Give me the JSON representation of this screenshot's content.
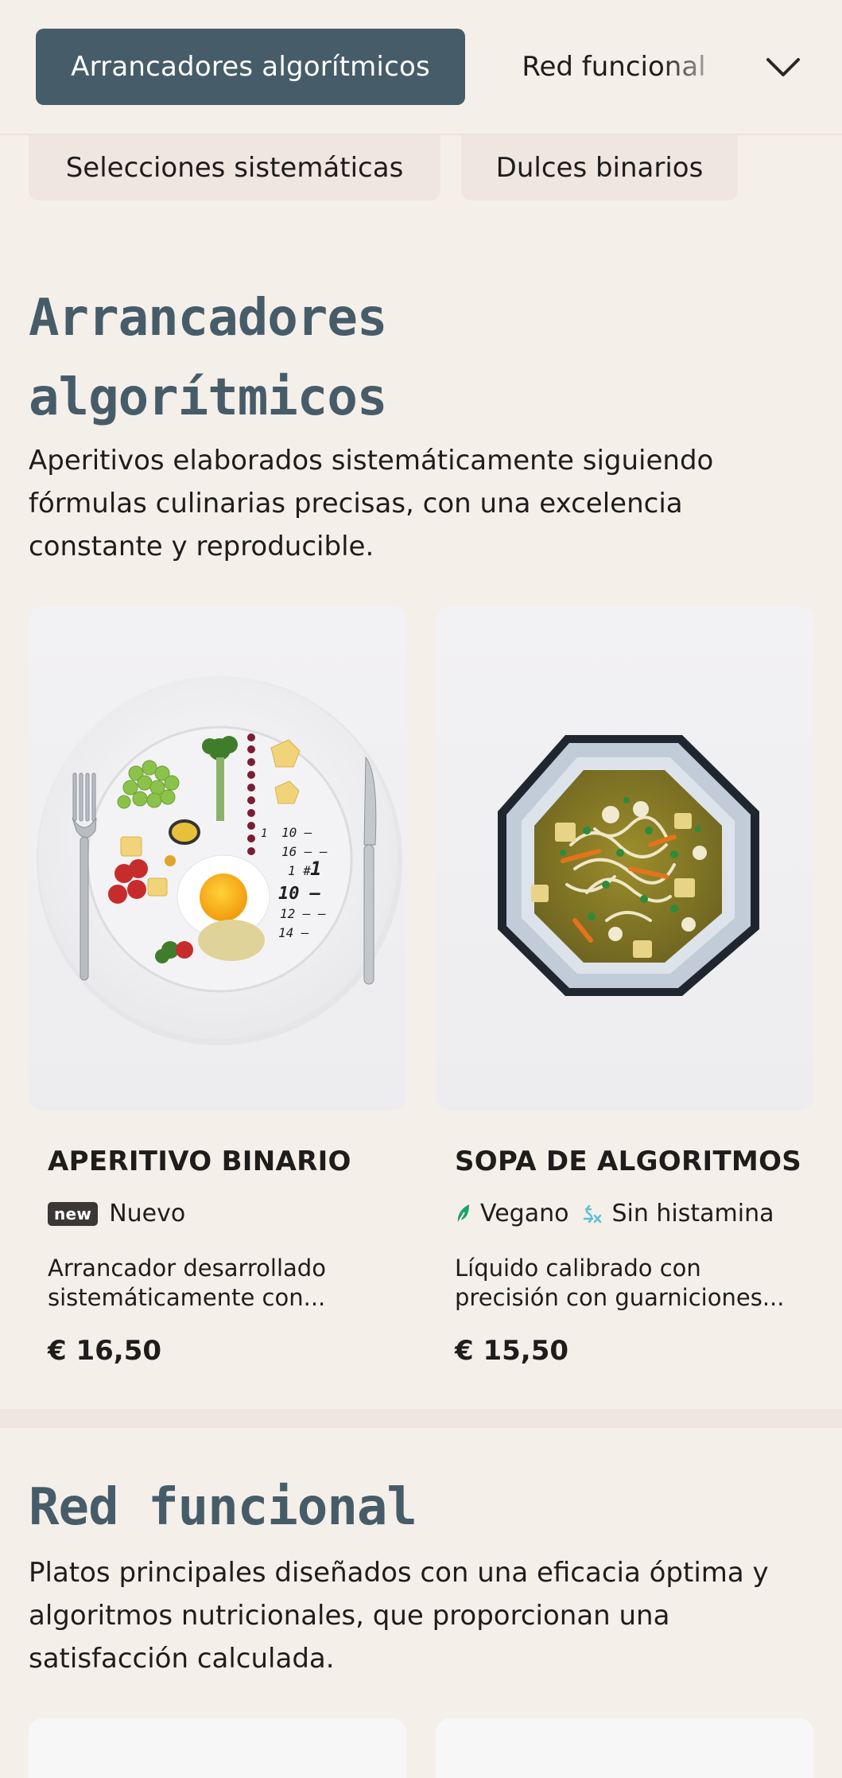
{
  "nav": {
    "active_tab": "Arrancadores algorítmicos",
    "tab_2": "Red funcional",
    "tab_3": "Selecciones sistemáticas",
    "tab_4": "Dulces binarios"
  },
  "sections": [
    {
      "title_line1": "Arrancadores",
      "title_line2": "algorítmicos",
      "description": "Aperitivos elaborados sistemáticamente siguiendo fórmulas culinarias precisas, con una excelencia constante y reproducible.",
      "items": [
        {
          "name": "APERITIVO BINARIO",
          "badge_new": "new",
          "badge_label": "Nuevo",
          "description_line1": "Arrancador desarrollado",
          "description_line2": "sistemáticamente con...",
          "price": "€ 16,50",
          "plate_numbers": [
            "1",
            "10 –",
            "16 – –",
            "1 #",
            "1",
            "10 —",
            "12 – –",
            "14 –"
          ]
        },
        {
          "name": "SOPA DE ALGORITMOS",
          "tag_1": "Vegano",
          "tag_2": "Sin histamina",
          "description_line1": "Líquido calibrado con",
          "description_line2": "precisión con guarniciones...",
          "price": "€ 15,50"
        }
      ]
    },
    {
      "title": "Red funcional",
      "description": "Platos principales diseñados con una eficacia óptima y algoritmos nutricionales, que proporcionan una satisfacción calculada."
    }
  ],
  "colors": {
    "background": "#f5efea",
    "accent": "#465c69",
    "vegan_icon": "#1aa36b",
    "histamine_icon": "#5cc0d6"
  }
}
